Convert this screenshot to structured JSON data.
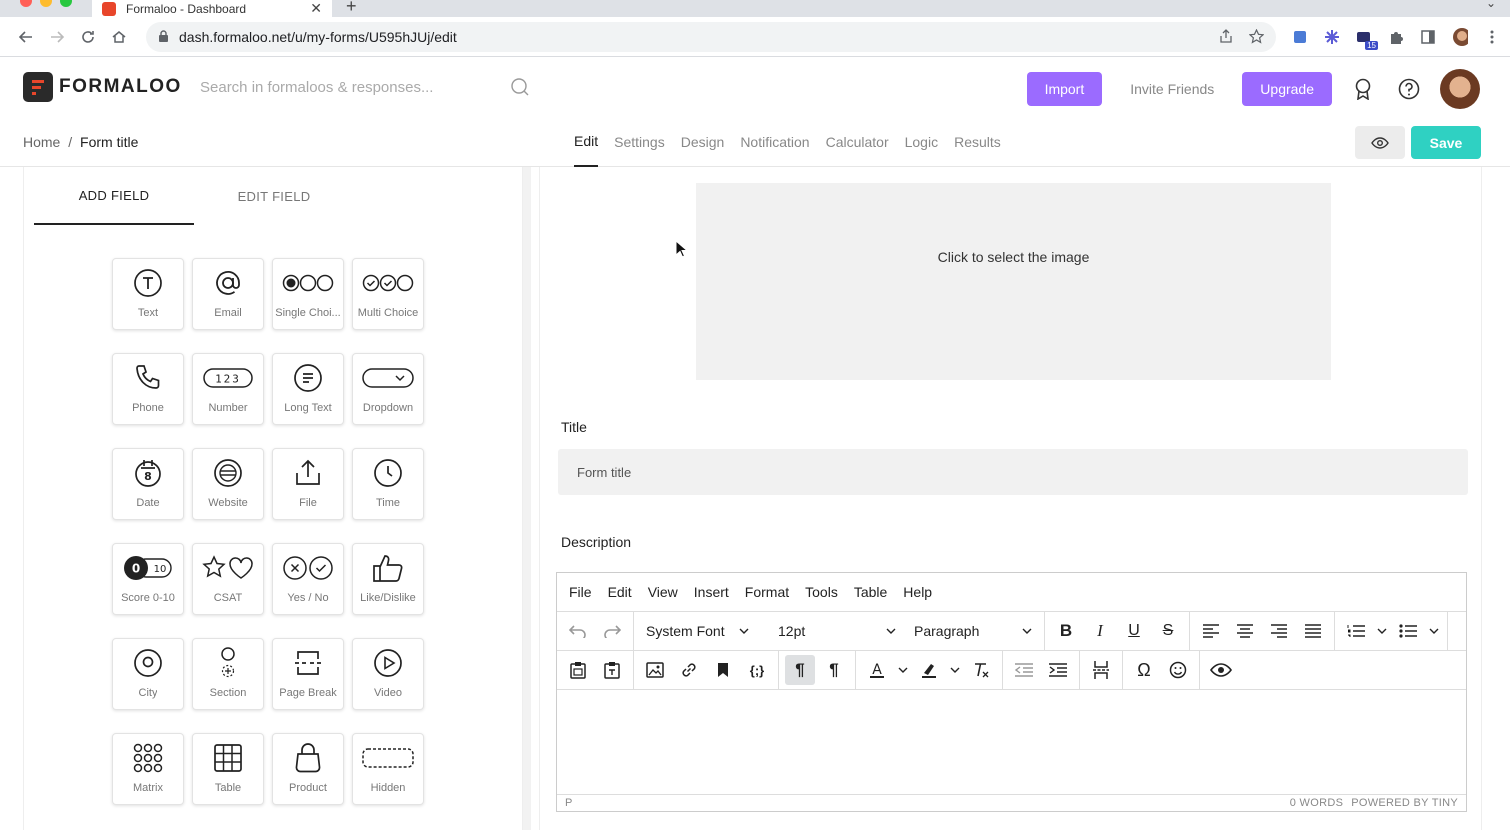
{
  "browser": {
    "tab_title": "Formaloo - Dashboard",
    "url": "dash.formaloo.net/u/my-forms/U595hJUj/edit",
    "extension_badge": "15"
  },
  "header": {
    "logo_text": "FORMALOO",
    "search_placeholder": "Search in formaloos & responses...",
    "import_label": "Import",
    "invite_label": "Invite Friends",
    "upgrade_label": "Upgrade"
  },
  "breadcrumb": {
    "home": "Home",
    "separator": "/",
    "current": "Form title"
  },
  "form_tabs": [
    "Edit",
    "Settings",
    "Design",
    "Notification",
    "Calculator",
    "Logic",
    "Results"
  ],
  "save_label": "Save",
  "left_panel": {
    "tabs": [
      "ADD FIELD",
      "EDIT FIELD"
    ],
    "fields": [
      {
        "label": "Text",
        "icon": "text-icon"
      },
      {
        "label": "Email",
        "icon": "at-icon"
      },
      {
        "label": "Single Choi...",
        "icon": "single-choice-icon"
      },
      {
        "label": "Multi Choice",
        "icon": "multi-choice-icon"
      },
      {
        "label": "Phone",
        "icon": "phone-icon"
      },
      {
        "label": "Number",
        "icon": "number-icon",
        "glyph": "123"
      },
      {
        "label": "Long Text",
        "icon": "long-text-icon"
      },
      {
        "label": "Dropdown",
        "icon": "dropdown-icon"
      },
      {
        "label": "Date",
        "icon": "calendar-icon",
        "glyph": "8"
      },
      {
        "label": "Website",
        "icon": "globe-icon"
      },
      {
        "label": "File",
        "icon": "upload-icon"
      },
      {
        "label": "Time",
        "icon": "clock-icon"
      },
      {
        "label": "Score 0-10",
        "icon": "score-icon",
        "glyph_a": "0",
        "glyph_b": "10"
      },
      {
        "label": "CSAT",
        "icon": "star-heart-icon"
      },
      {
        "label": "Yes / No",
        "icon": "yes-no-icon"
      },
      {
        "label": "Like/Dislike",
        "icon": "thumbs-up-icon"
      },
      {
        "label": "City",
        "icon": "location-icon"
      },
      {
        "label": "Section",
        "icon": "section-icon"
      },
      {
        "label": "Page Break",
        "icon": "page-break-icon"
      },
      {
        "label": "Video",
        "icon": "play-icon"
      },
      {
        "label": "Matrix",
        "icon": "matrix-icon"
      },
      {
        "label": "Table",
        "icon": "table-icon"
      },
      {
        "label": "Product",
        "icon": "bag-icon"
      },
      {
        "label": "Hidden",
        "icon": "hidden-icon"
      }
    ]
  },
  "right_panel": {
    "image_placeholder": "Click to select the image",
    "title_label": "Title",
    "title_value": "Form title",
    "description_label": "Description"
  },
  "editor": {
    "menu": [
      "File",
      "Edit",
      "View",
      "Insert",
      "Format",
      "Tools",
      "Table",
      "Help"
    ],
    "font": "System Font",
    "size": "12pt",
    "block": "Paragraph",
    "status_path": "P",
    "word_count": "0 WORDS",
    "powered_by": "POWERED BY TINY"
  },
  "colors": {
    "primary_purple": "#9b6bff",
    "save_teal": "#2fd1c2",
    "logo_red": "#e8462b"
  }
}
